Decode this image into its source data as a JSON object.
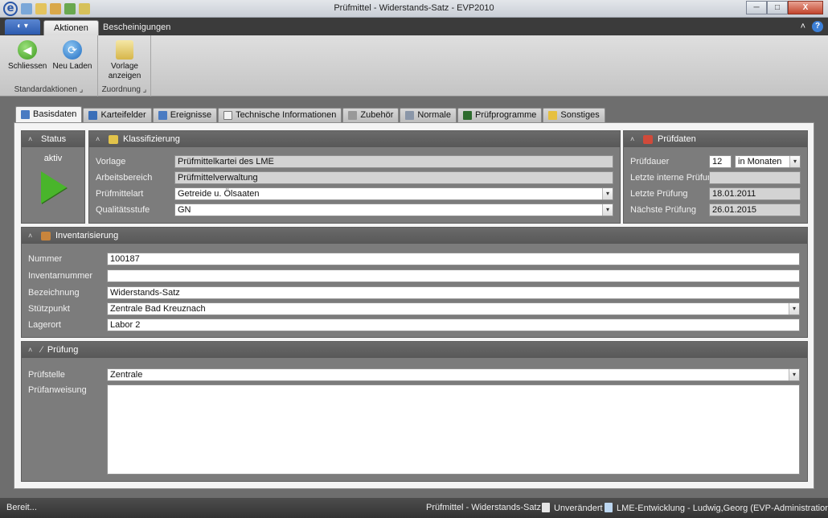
{
  "window": {
    "title": "Prüfmittel - Widerstands-Satz - EVP2010",
    "app_logo": "e"
  },
  "window_buttons": {
    "minimize": "─",
    "maximize": "□",
    "close": "X"
  },
  "ribbon_tabs": {
    "app_menu": "◐ ▾",
    "aktionen": "Aktionen",
    "bescheinigungen": "Bescheinigungen"
  },
  "ribbon": {
    "schliessen": "Schliessen",
    "neu_laden": "Neu Laden",
    "vorlage_anzeigen_1": "Vorlage",
    "vorlage_anzeigen_2": "anzeigen",
    "group_standard": "Standardaktionen",
    "group_zuordnung": "Zuordnung"
  },
  "content_tabs": {
    "basisdaten": "Basisdaten",
    "karteifelder": "Karteifelder",
    "ereignisse": "Ereignisse",
    "technische": "Technische Informationen",
    "zubehoer": "Zubehör",
    "normale": "Normale",
    "pruefprogramme": "Prüfprogramme",
    "sonstiges": "Sonstiges"
  },
  "status": {
    "header": "Status",
    "value": "aktiv"
  },
  "klassifizierung": {
    "header": "Klassifizierung",
    "vorlage_label": "Vorlage",
    "vorlage": "Prüfmittelkartei des LME",
    "arbeitsbereich_label": "Arbeitsbereich",
    "arbeitsbereich": "Prüfmittelverwaltung",
    "pruefmittelart_label": "Prüfmittelart",
    "pruefmittelart": "Getreide u. Ölsaaten",
    "qualitaetsstufe_label": "Qualitätsstufe",
    "qualitaetsstufe": "GN"
  },
  "pruefdaten": {
    "header": "Prüfdaten",
    "pruefdauer_label": "Prüfdauer",
    "pruefdauer": "12",
    "einheit": "in Monaten",
    "letzte_interne_label": "Letzte interne Prüfung",
    "letzte_interne": "",
    "letzte_label": "Letzte Prüfung",
    "letzte": "18.01.2011",
    "naechste_label": "Nächste Prüfung",
    "naechste": "26.01.2015"
  },
  "inventarisierung": {
    "header": "Inventarisierung",
    "nummer_label": "Nummer",
    "nummer": "100187",
    "inventarnummer_label": "Inventarnummer",
    "inventarnummer": "",
    "bezeichnung_label": "Bezeichnung",
    "bezeichnung": "Widerstands-Satz",
    "stuetzpunkt_label": "Stützpunkt",
    "stuetzpunkt": "Zentrale Bad Kreuznach",
    "lagerort_label": "Lagerort",
    "lagerort": "Labor 2"
  },
  "pruefung": {
    "header": "Prüfung",
    "pruefstelle_label": "Prüfstelle",
    "pruefstelle": "Zentrale",
    "pruefanweisung_label": "Prüfanweisung",
    "pruefanweisung": ""
  },
  "statusbar": {
    "left": "Bereit...",
    "record": "Prüfmittel - Widerstands-Satz",
    "state": "Unverändert",
    "user": "LME-Entwicklung - Ludwig,Georg (EVP-Administration)"
  },
  "colors": {
    "panel_bg": "#7c7c7c",
    "accent_green": "#49b52b",
    "ribbon_dark": "#3b3b3b"
  }
}
